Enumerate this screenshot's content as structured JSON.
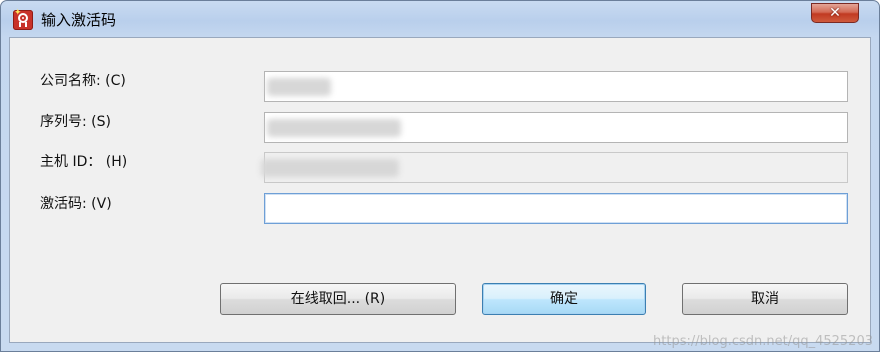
{
  "window": {
    "title": "输入激活码",
    "close_symbol": "✕",
    "app_icon": "red-badge-app-icon",
    "spark_glyph": "✦"
  },
  "form": {
    "company_label": "公司名称: (C)",
    "serial_label": "序列号: (S)",
    "host_id_label": "主机 ID： (H)",
    "activation_label": "激活码: (V)",
    "activation_value": ""
  },
  "buttons": {
    "online_label": "在线取回... (R)",
    "ok_label": "确定",
    "cancel_label": "取消"
  },
  "watermark": "https://blog.csdn.net/qq_4525203",
  "colors": {
    "titlebar": "#c4d7ef",
    "client_bg": "#f0f0f0",
    "close_red": "#c13a22",
    "default_button_border": "#3c7fb1"
  }
}
